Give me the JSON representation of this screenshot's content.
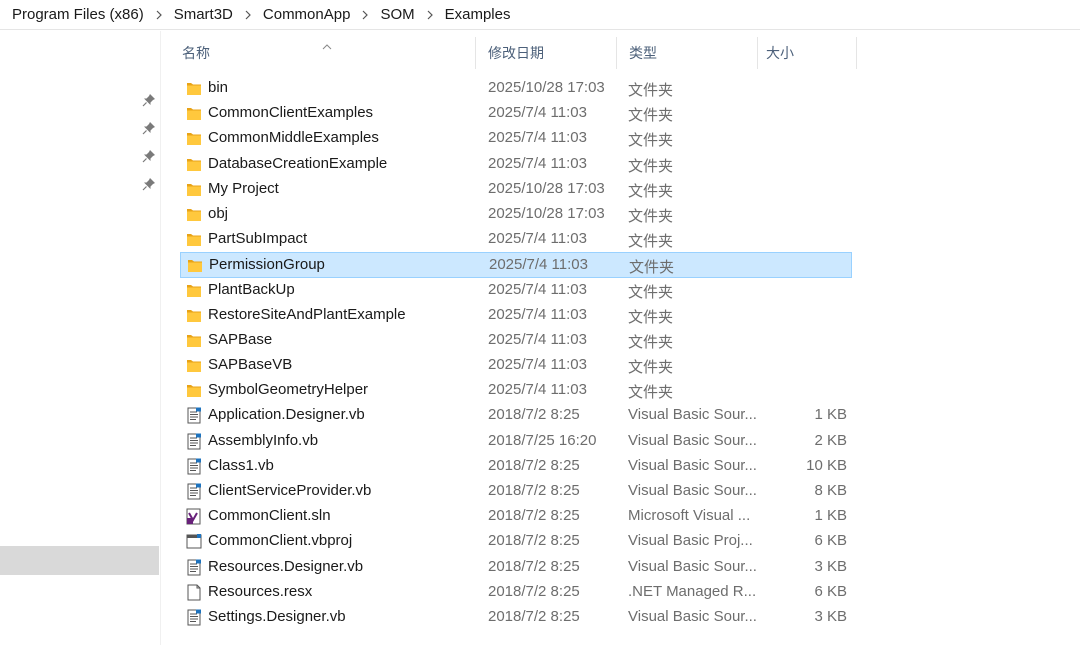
{
  "breadcrumb": [
    "Program Files (x86)",
    "Smart3D",
    "CommonApp",
    "SOM",
    "Examples"
  ],
  "columns": {
    "name": "名称",
    "date": "修改日期",
    "type": "类型",
    "size": "大小"
  },
  "colors": {
    "selected_row": "#cce8ff",
    "selected_border": "#99d1ff",
    "folder": "#ffc83d",
    "header_text": "#4c607a"
  },
  "files": [
    {
      "name": "bin",
      "date": "2025/10/28 17:03",
      "type": "文件夹",
      "size": "",
      "icon": "folder-icon"
    },
    {
      "name": "CommonClientExamples",
      "date": "2025/7/4 11:03",
      "type": "文件夹",
      "size": "",
      "icon": "folder-icon"
    },
    {
      "name": "CommonMiddleExamples",
      "date": "2025/7/4 11:03",
      "type": "文件夹",
      "size": "",
      "icon": "folder-icon"
    },
    {
      "name": "DatabaseCreationExample",
      "date": "2025/7/4 11:03",
      "type": "文件夹",
      "size": "",
      "icon": "folder-icon"
    },
    {
      "name": "My Project",
      "date": "2025/10/28 17:03",
      "type": "文件夹",
      "size": "",
      "icon": "folder-icon"
    },
    {
      "name": "obj",
      "date": "2025/10/28 17:03",
      "type": "文件夹",
      "size": "",
      "icon": "folder-icon"
    },
    {
      "name": "PartSubImpact",
      "date": "2025/7/4 11:03",
      "type": "文件夹",
      "size": "",
      "icon": "folder-icon"
    },
    {
      "name": "PermissionGroup",
      "date": "2025/7/4 11:03",
      "type": "文件夹",
      "size": "",
      "icon": "folder-icon",
      "selected": true
    },
    {
      "name": "PlantBackUp",
      "date": "2025/7/4 11:03",
      "type": "文件夹",
      "size": "",
      "icon": "folder-icon"
    },
    {
      "name": "RestoreSiteAndPlantExample",
      "date": "2025/7/4 11:03",
      "type": "文件夹",
      "size": "",
      "icon": "folder-icon"
    },
    {
      "name": "SAPBase",
      "date": "2025/7/4 11:03",
      "type": "文件夹",
      "size": "",
      "icon": "folder-icon"
    },
    {
      "name": "SAPBaseVB",
      "date": "2025/7/4 11:03",
      "type": "文件夹",
      "size": "",
      "icon": "folder-icon"
    },
    {
      "name": "SymbolGeometryHelper",
      "date": "2025/7/4 11:03",
      "type": "文件夹",
      "size": "",
      "icon": "folder-icon"
    },
    {
      "name": "Application.Designer.vb",
      "date": "2018/7/2 8:25",
      "type": "Visual Basic Sour...",
      "size": "1 KB",
      "icon": "vb-file-icon"
    },
    {
      "name": "AssemblyInfo.vb",
      "date": "2018/7/25 16:20",
      "type": "Visual Basic Sour...",
      "size": "2 KB",
      "icon": "vb-file-icon"
    },
    {
      "name": "Class1.vb",
      "date": "2018/7/2 8:25",
      "type": "Visual Basic Sour...",
      "size": "10 KB",
      "icon": "vb-file-icon"
    },
    {
      "name": "ClientServiceProvider.vb",
      "date": "2018/7/2 8:25",
      "type": "Visual Basic Sour...",
      "size": "8 KB",
      "icon": "vb-file-icon"
    },
    {
      "name": "CommonClient.sln",
      "date": "2018/7/2 8:25",
      "type": "Microsoft Visual ...",
      "size": "1 KB",
      "icon": "sln-file-icon"
    },
    {
      "name": "CommonClient.vbproj",
      "date": "2018/7/2 8:25",
      "type": "Visual Basic Proj...",
      "size": "6 KB",
      "icon": "vbproj-file-icon"
    },
    {
      "name": "Resources.Designer.vb",
      "date": "2018/7/2 8:25",
      "type": "Visual Basic Sour...",
      "size": "3 KB",
      "icon": "vb-file-icon"
    },
    {
      "name": "Resources.resx",
      "date": "2018/7/2 8:25",
      "type": ".NET Managed R...",
      "size": "6 KB",
      "icon": "resx-file-icon"
    },
    {
      "name": "Settings.Designer.vb",
      "date": "2018/7/2 8:25",
      "type": "Visual Basic Sour...",
      "size": "3 KB",
      "icon": "vb-file-icon"
    }
  ]
}
